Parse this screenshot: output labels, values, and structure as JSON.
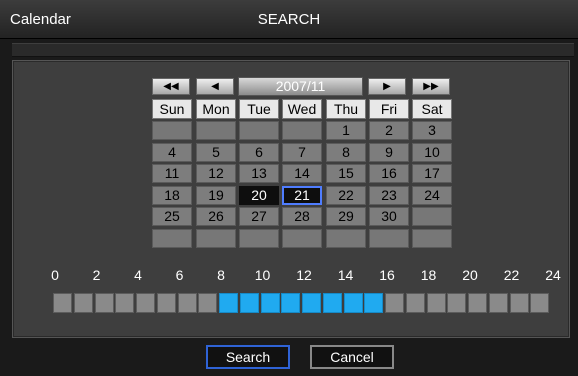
{
  "window": {
    "app_label": "Calendar",
    "screen_title": "SEARCH"
  },
  "calendar": {
    "nav": {
      "prev_year": "◀◀",
      "prev_month": "◀",
      "next_month": "▶",
      "next_year": "▶▶"
    },
    "month_label": "2007/11",
    "day_names": [
      "Sun",
      "Mon",
      "Tue",
      "Wed",
      "Thu",
      "Fri",
      "Sat"
    ],
    "weeks": [
      [
        "",
        "",
        "",
        "",
        "1",
        "2",
        "3"
      ],
      [
        "4",
        "5",
        "6",
        "7",
        "8",
        "9",
        "10"
      ],
      [
        "11",
        "12",
        "13",
        "14",
        "15",
        "16",
        "17"
      ],
      [
        "18",
        "19",
        "20",
        "21",
        "22",
        "23",
        "24"
      ],
      [
        "25",
        "26",
        "27",
        "28",
        "29",
        "30",
        ""
      ],
      [
        "",
        "",
        "",
        "",
        "",
        "",
        ""
      ]
    ],
    "highlighted_day": "20",
    "selected_day": "21"
  },
  "timeline": {
    "hour_labels": [
      "0",
      "2",
      "4",
      "6",
      "8",
      "10",
      "12",
      "14",
      "16",
      "18",
      "20",
      "22",
      "24"
    ],
    "blocks_active": [
      false,
      false,
      false,
      false,
      false,
      false,
      false,
      false,
      true,
      true,
      true,
      true,
      true,
      true,
      true,
      true,
      false,
      false,
      false,
      false,
      false,
      false,
      false,
      false
    ],
    "active_color": "#20aaf0",
    "inactive_color": "#8a8a8a"
  },
  "actions": {
    "search_label": "Search",
    "cancel_label": "Cancel"
  }
}
